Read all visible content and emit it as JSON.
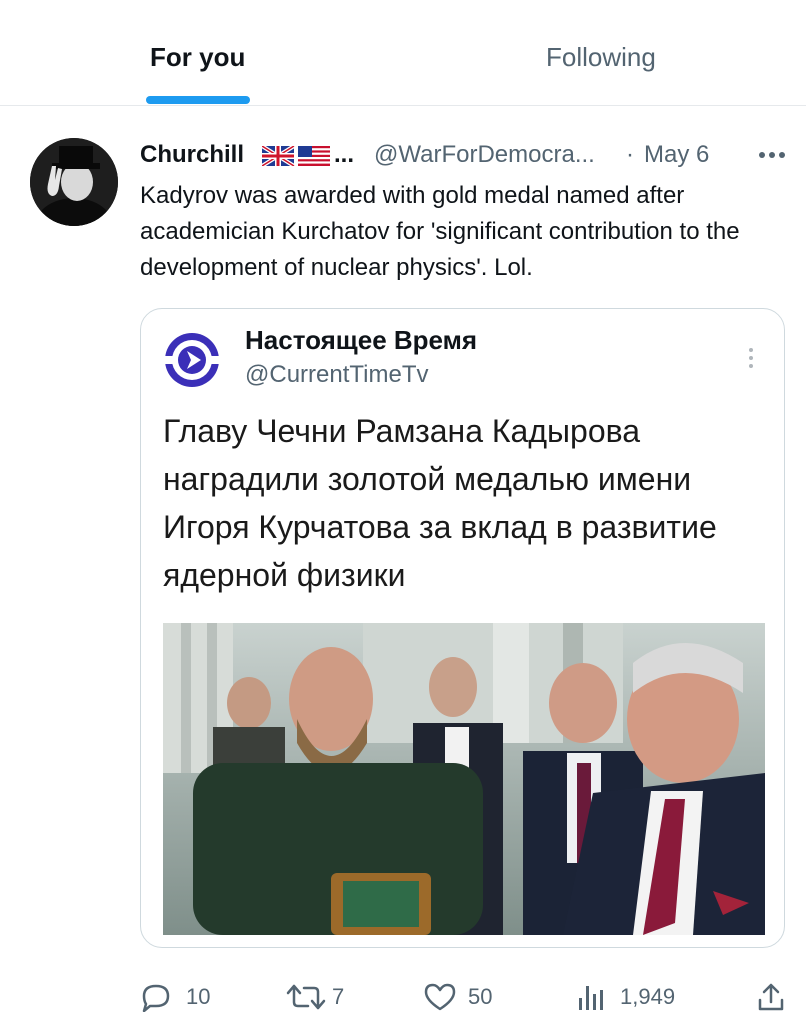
{
  "tabs": {
    "for_you": "For you",
    "following": "Following",
    "active": "for_you",
    "accent_color": "#1d9bf0"
  },
  "tweet": {
    "display_name": "Churchill",
    "name_suffix": "...",
    "flags": [
      "uk-flag-icon",
      "us-flag-icon"
    ],
    "handle": "@WarForDemocra...",
    "separator": "·",
    "date": "May 6",
    "text": "Kadyrov was awarded with gold medal named after academician Kurchatov for 'significant contribution to the development of nuclear physics'. Lol."
  },
  "quote": {
    "name": "Настоящее Время",
    "handle": "@CurrentTimeTv",
    "headline": "Главу Чечни Рамзана Кадырова наградили золотой медалью имени Игоря Курчатова за вклад в развитие ядерной физики",
    "logo_color": "#3b2fb8"
  },
  "actions": {
    "replies": "10",
    "retweets": "7",
    "likes": "50",
    "views": "1,949"
  }
}
